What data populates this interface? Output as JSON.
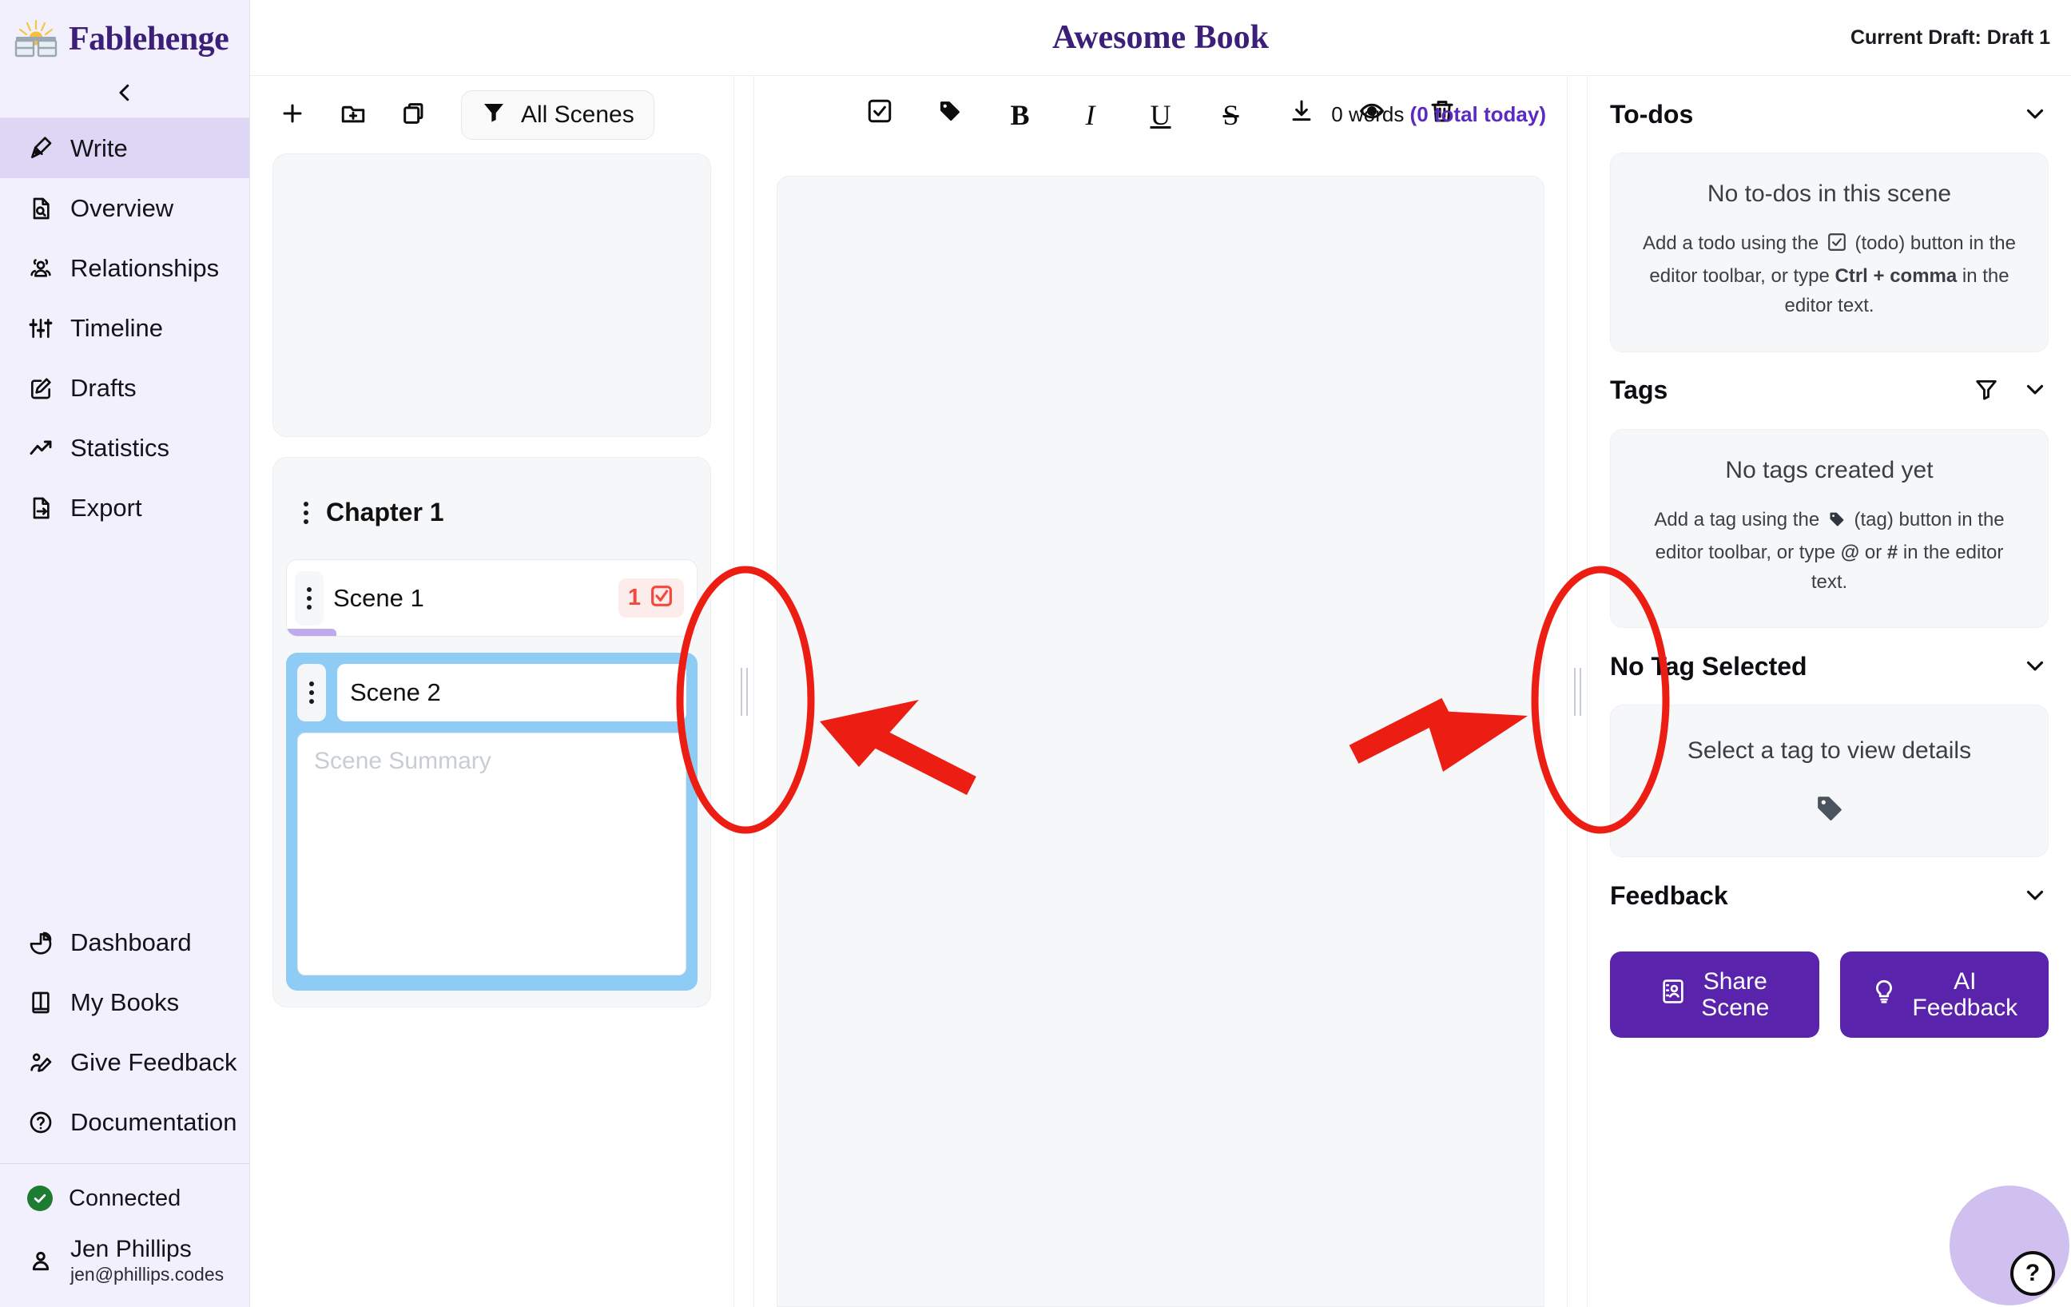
{
  "brand": {
    "name": "Fablehenge",
    "logo_icon": "stonehenge-sun-logo"
  },
  "sidebar": {
    "collapse_icon": "chevron-left-icon",
    "primary_items": [
      {
        "label": "Write",
        "icon": "pen-nib-icon",
        "active": true
      },
      {
        "label": "Overview",
        "icon": "document-search-icon",
        "active": false
      },
      {
        "label": "Relationships",
        "icon": "users-group-icon",
        "active": false
      },
      {
        "label": "Timeline",
        "icon": "sliders-icon",
        "active": false
      },
      {
        "label": "Drafts",
        "icon": "pencil-square-icon",
        "active": false
      },
      {
        "label": "Statistics",
        "icon": "line-chart-icon",
        "active": false
      },
      {
        "label": "Export",
        "icon": "document-export-icon",
        "active": false
      }
    ],
    "secondary_items": [
      {
        "label": "Dashboard",
        "icon": "pie-chart-icon"
      },
      {
        "label": "My Books",
        "icon": "book-icon"
      },
      {
        "label": "Give Feedback",
        "icon": "person-pencil-icon"
      },
      {
        "label": "Documentation",
        "icon": "question-circle-icon"
      }
    ],
    "status": {
      "label": "Connected",
      "icon": "check-circle-icon",
      "color": "#1e7b32"
    },
    "user": {
      "name": "Jen Phillips",
      "email": "jen@phillips.codes",
      "icon": "person-icon"
    }
  },
  "header": {
    "book_title": "Awesome Book",
    "draft_label": "Current Draft: Draft 1",
    "title_color": "#3b1f78"
  },
  "scene_toolbar": {
    "add_scene_icon": "plus-icon",
    "add_chapter_icon": "folder-plus-icon",
    "duplicate_icon": "copy-icon",
    "filter_icon": "funnel-icon",
    "filter_label": "All Scenes"
  },
  "scene_list": {
    "chapter": {
      "title": "Chapter 1",
      "menu_icon": "kebab-menu-icon"
    },
    "scenes": [
      {
        "name": "Scene 1",
        "menu_icon": "kebab-menu-icon",
        "todo_count": "1",
        "todo_icon": "checkbox-icon",
        "badge_color": "#f4483f",
        "editing": false
      },
      {
        "name": "Scene 2",
        "menu_icon": "kebab-menu-icon",
        "summary_value": "",
        "summary_placeholder": "Scene Summary",
        "editing": true
      }
    ]
  },
  "editor": {
    "toolbar": [
      {
        "icon": "checkbox-todo-icon",
        "label": ""
      },
      {
        "icon": "tag-icon",
        "label": ""
      },
      {
        "icon": "bold-icon",
        "label": "B"
      },
      {
        "icon": "italic-icon",
        "label": "I"
      },
      {
        "icon": "underline-icon",
        "label": "U"
      },
      {
        "icon": "strikethrough-icon",
        "label": "S"
      },
      {
        "icon": "download-icon",
        "label": ""
      },
      {
        "icon": "eye-icon",
        "label": ""
      },
      {
        "icon": "trash-icon",
        "label": ""
      }
    ],
    "word_count": "0 words ",
    "total_today": "(0 total today)",
    "accent_color": "#5b2bc0",
    "content": ""
  },
  "right_panel": {
    "todos": {
      "title": "To-dos",
      "collapse_icon": "chevron-down-icon",
      "empty_title": "No to-dos in this scene",
      "help_prefix": "Add a todo using the ",
      "help_mid": " (todo) button in the editor toolbar, or type ",
      "help_bold": "Ctrl + comma",
      "help_suffix": " in the editor text."
    },
    "tags": {
      "title": "Tags",
      "filter_icon": "funnel-outline-icon",
      "collapse_icon": "chevron-down-icon",
      "empty_title": "No tags created yet",
      "help_prefix": "Add a tag using the ",
      "help_mid": " (tag) button in the editor toolbar, or type ",
      "help_at": "@",
      "help_or": " or ",
      "help_hash": "#",
      "help_suffix": " in the editor text."
    },
    "tag_detail": {
      "title": "No Tag Selected",
      "collapse_icon": "chevron-down-icon",
      "empty_title": "Select a tag to view details",
      "tag_icon": "tag-icon"
    },
    "feedback": {
      "title": "Feedback",
      "collapse_icon": "chevron-down-icon",
      "share_label": "Share\nScene",
      "share_line1": "Share",
      "share_line2": "Scene",
      "share_icon": "contact-card-icon",
      "ai_line1": "AI",
      "ai_line2": "Feedback",
      "ai_icon": "lightbulb-icon",
      "button_color": "#5a23ac"
    }
  },
  "resizers": {
    "left_handle_icon": "vertical-grip-icon",
    "right_handle_icon": "vertical-grip-icon"
  },
  "annotations": {
    "color": "#ec1d12",
    "left_ellipse_label": "left-resizer-highlight",
    "right_ellipse_label": "right-resizer-highlight",
    "left_arrow_label": "arrow-pointing-left",
    "right_arrow_label": "arrow-pointing-right"
  },
  "help_fab": {
    "label": "?",
    "icon": "question-mark-icon"
  }
}
